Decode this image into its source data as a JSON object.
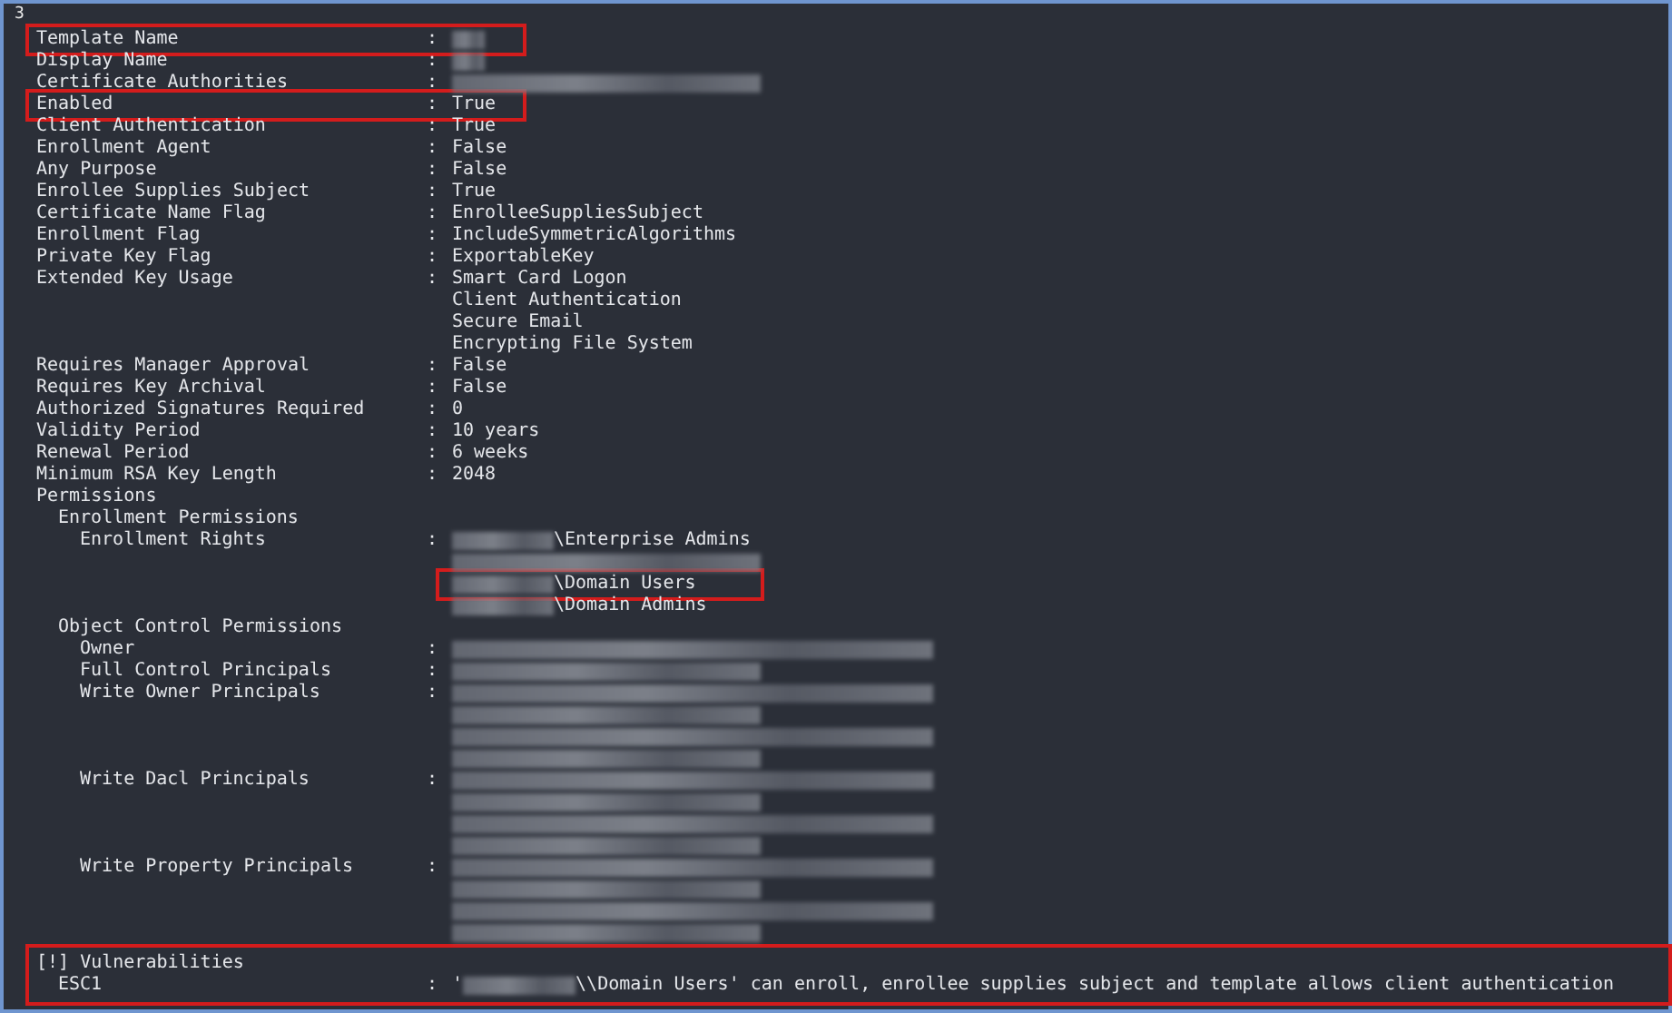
{
  "prompt_text": "3",
  "fields": [
    {
      "label": "Template Name",
      "separator": ":",
      "highlighted": true,
      "values": [
        {
          "redacted": true,
          "kind": "short",
          "highlighted": false
        }
      ]
    },
    {
      "label": "Display Name",
      "separator": ":",
      "highlighted": false,
      "values": [
        {
          "redacted": true,
          "kind": "short",
          "highlighted": false
        }
      ]
    },
    {
      "label": "Certificate Authorities",
      "separator": ":",
      "highlighted": false,
      "values": [
        {
          "redacted": true,
          "kind": "medium",
          "highlighted": false
        }
      ]
    },
    {
      "label": "Enabled",
      "separator": ":",
      "highlighted": true,
      "values": [
        {
          "text": "True",
          "redacted": false,
          "highlighted": false
        }
      ]
    },
    {
      "label": "Client Authentication",
      "separator": ":",
      "highlighted": false,
      "values": [
        {
          "text": "True",
          "redacted": false,
          "highlighted": false
        }
      ]
    },
    {
      "label": "Enrollment Agent",
      "separator": ":",
      "highlighted": false,
      "values": [
        {
          "text": "False",
          "redacted": false,
          "highlighted": false
        }
      ]
    },
    {
      "label": "Any Purpose",
      "separator": ":",
      "highlighted": false,
      "values": [
        {
          "text": "False",
          "redacted": false,
          "highlighted": false
        }
      ]
    },
    {
      "label": "Enrollee Supplies Subject",
      "separator": ":",
      "highlighted": false,
      "values": [
        {
          "text": "True",
          "redacted": false,
          "highlighted": false
        }
      ]
    },
    {
      "label": "Certificate Name Flag",
      "separator": ":",
      "highlighted": false,
      "values": [
        {
          "text": "EnrolleeSuppliesSubject",
          "redacted": false,
          "highlighted": false
        }
      ]
    },
    {
      "label": "Enrollment Flag",
      "separator": ":",
      "highlighted": false,
      "values": [
        {
          "text": "IncludeSymmetricAlgorithms",
          "redacted": false,
          "highlighted": false
        }
      ]
    },
    {
      "label": "Private Key Flag",
      "separator": ":",
      "highlighted": false,
      "values": [
        {
          "text": "ExportableKey",
          "redacted": false,
          "highlighted": false
        }
      ]
    },
    {
      "label": "Extended Key Usage",
      "separator": ":",
      "highlighted": false,
      "values": [
        {
          "text": "Smart Card Logon",
          "redacted": false,
          "highlighted": false
        },
        {
          "text": "Client Authentication",
          "redacted": false,
          "highlighted": false
        },
        {
          "text": "Secure Email",
          "redacted": false,
          "highlighted": false
        },
        {
          "text": "Encrypting File System",
          "redacted": false,
          "highlighted": false
        }
      ]
    },
    {
      "label": "Requires Manager Approval",
      "separator": ":",
      "highlighted": false,
      "values": [
        {
          "text": "False",
          "redacted": false,
          "highlighted": false
        }
      ]
    },
    {
      "label": "Requires Key Archival",
      "separator": ":",
      "highlighted": false,
      "values": [
        {
          "text": "False",
          "redacted": false,
          "highlighted": false
        }
      ]
    },
    {
      "label": "Authorized Signatures Required",
      "separator": ":",
      "highlighted": false,
      "values": [
        {
          "text": "0",
          "redacted": false,
          "highlighted": false
        }
      ]
    },
    {
      "label": "Validity Period",
      "separator": ":",
      "highlighted": false,
      "values": [
        {
          "text": "10 years",
          "redacted": false,
          "highlighted": false
        }
      ]
    },
    {
      "label": "Renewal Period",
      "separator": ":",
      "highlighted": false,
      "values": [
        {
          "text": "6 weeks",
          "redacted": false,
          "highlighted": false
        }
      ]
    },
    {
      "label": "Minimum RSA Key Length",
      "separator": ":",
      "highlighted": false,
      "values": [
        {
          "text": "2048",
          "redacted": false,
          "highlighted": false
        }
      ]
    },
    {
      "label": "Permissions",
      "highlighted": false,
      "children": [
        {
          "label": "Enrollment Permissions",
          "highlighted": false,
          "children": [
            {
              "label": "Enrollment Rights",
              "separator": ":",
              "highlighted": false,
              "values": [
                {
                  "text": "\\Enterprise Admins",
                  "redacted": true,
                  "kind": "prefix",
                  "highlighted": false
                },
                {
                  "redacted": true,
                  "kind": "medium",
                  "highlighted": false
                },
                {
                  "text": "\\Domain Users",
                  "redacted": true,
                  "kind": "prefix",
                  "highlighted": true
                },
                {
                  "text": "\\Domain Admins",
                  "redacted": true,
                  "kind": "prefix",
                  "highlighted": false
                }
              ]
            }
          ]
        },
        {
          "label": "Object Control Permissions",
          "highlighted": false,
          "children": [
            {
              "label": "Owner",
              "separator": ":",
              "highlighted": false,
              "values": [
                {
                  "redacted": true,
                  "kind": "long",
                  "highlighted": false
                }
              ]
            },
            {
              "label": "Full Control Principals",
              "separator": ":",
              "highlighted": false,
              "values": [
                {
                  "redacted": true,
                  "kind": "medium",
                  "highlighted": false
                }
              ]
            },
            {
              "label": "Write Owner Principals",
              "separator": ":",
              "highlighted": false,
              "values": [
                {
                  "redacted": true,
                  "kind": "long",
                  "highlighted": false
                },
                {
                  "redacted": true,
                  "kind": "medium",
                  "highlighted": false
                },
                {
                  "redacted": true,
                  "kind": "long",
                  "highlighted": false
                },
                {
                  "redacted": true,
                  "kind": "medium",
                  "highlighted": false
                }
              ]
            },
            {
              "label": "Write Dacl Principals",
              "separator": ":",
              "highlighted": false,
              "values": [
                {
                  "redacted": true,
                  "kind": "long",
                  "highlighted": false
                },
                {
                  "redacted": true,
                  "kind": "medium",
                  "highlighted": false
                },
                {
                  "redacted": true,
                  "kind": "long",
                  "highlighted": false
                },
                {
                  "redacted": true,
                  "kind": "medium",
                  "highlighted": false
                }
              ]
            },
            {
              "label": "Write Property Principals",
              "separator": ":",
              "highlighted": false,
              "values": [
                {
                  "redacted": true,
                  "kind": "long",
                  "highlighted": false
                },
                {
                  "redacted": true,
                  "kind": "medium",
                  "highlighted": false
                },
                {
                  "redacted": true,
                  "kind": "long",
                  "highlighted": false
                },
                {
                  "redacted": true,
                  "kind": "medium",
                  "highlighted": false
                }
              ]
            }
          ]
        }
      ]
    }
  ],
  "vulnerabilities": {
    "title": "[!] Vulnerabilities",
    "highlighted": true,
    "items": [
      {
        "label": "ESC1",
        "separator": ":",
        "before": "'",
        "redacted": true,
        "text": "\\\\Domain Users' can enroll, enrollee supplies subject and template allows client authentication"
      }
    ]
  }
}
